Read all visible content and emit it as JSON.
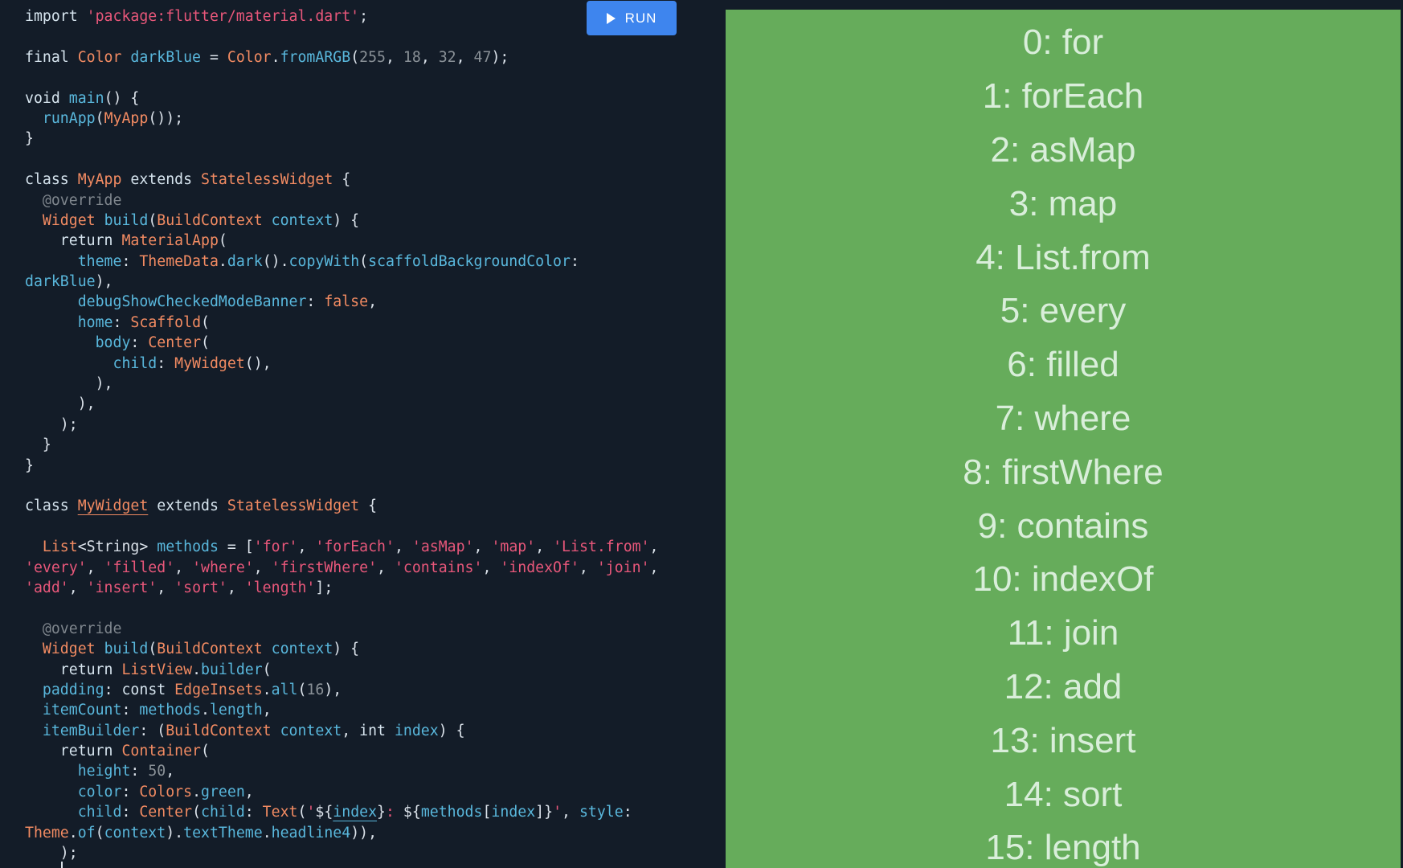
{
  "toolbar": {
    "run_label": "RUN"
  },
  "code_lines": [
    [
      [
        "kw",
        "import "
      ],
      [
        "st",
        "'package:flutter/material.dart'"
      ],
      [
        "pl",
        ";"
      ]
    ],
    [],
    [
      [
        "kw",
        "final "
      ],
      [
        "ty",
        "Color "
      ],
      [
        "id",
        "darkBlue"
      ],
      [
        "pl",
        " = "
      ],
      [
        "ty",
        "Color"
      ],
      [
        "pl",
        "."
      ],
      [
        "id",
        "fromARGB"
      ],
      [
        "pl",
        "("
      ],
      [
        "nu",
        "255"
      ],
      [
        "pl",
        ", "
      ],
      [
        "nu",
        "18"
      ],
      [
        "pl",
        ", "
      ],
      [
        "nu",
        "32"
      ],
      [
        "pl",
        ", "
      ],
      [
        "nu",
        "47"
      ],
      [
        "pl",
        ");"
      ]
    ],
    [],
    [
      [
        "kw",
        "void "
      ],
      [
        "id",
        "main"
      ],
      [
        "pl",
        "() {"
      ]
    ],
    [
      [
        "pl",
        "  "
      ],
      [
        "id",
        "runApp"
      ],
      [
        "pl",
        "("
      ],
      [
        "ty",
        "MyApp"
      ],
      [
        "pl",
        "());"
      ]
    ],
    [
      [
        "pl",
        "}"
      ]
    ],
    [],
    [
      [
        "kw",
        "class "
      ],
      [
        "ty",
        "MyApp "
      ],
      [
        "kw",
        "extends "
      ],
      [
        "ty",
        "StatelessWidget"
      ],
      [
        "pl",
        " {"
      ]
    ],
    [
      [
        "an",
        "  @override"
      ]
    ],
    [
      [
        "pl",
        "  "
      ],
      [
        "ty",
        "Widget "
      ],
      [
        "id",
        "build"
      ],
      [
        "pl",
        "("
      ],
      [
        "ty",
        "BuildContext "
      ],
      [
        "id",
        "context"
      ],
      [
        "pl",
        ") {"
      ]
    ],
    [
      [
        "kw",
        "    return "
      ],
      [
        "ty",
        "MaterialApp"
      ],
      [
        "pl",
        "("
      ]
    ],
    [
      [
        "pl",
        "      "
      ],
      [
        "id",
        "theme"
      ],
      [
        "pl",
        ": "
      ],
      [
        "ty",
        "ThemeData"
      ],
      [
        "pl",
        "."
      ],
      [
        "id",
        "dark"
      ],
      [
        "pl",
        "()."
      ],
      [
        "id",
        "copyWith"
      ],
      [
        "pl",
        "("
      ],
      [
        "id",
        "scaffoldBackgroundColor"
      ],
      [
        "pl",
        ":"
      ]
    ],
    [
      [
        "id",
        "darkBlue"
      ],
      [
        "pl",
        "),"
      ]
    ],
    [
      [
        "pl",
        "      "
      ],
      [
        "id",
        "debugShowCheckedModeBanner"
      ],
      [
        "pl",
        ": "
      ],
      [
        "ty",
        "false"
      ],
      [
        "pl",
        ","
      ]
    ],
    [
      [
        "pl",
        "      "
      ],
      [
        "id",
        "home"
      ],
      [
        "pl",
        ": "
      ],
      [
        "ty",
        "Scaffold"
      ],
      [
        "pl",
        "("
      ]
    ],
    [
      [
        "pl",
        "        "
      ],
      [
        "id",
        "body"
      ],
      [
        "pl",
        ": "
      ],
      [
        "ty",
        "Center"
      ],
      [
        "pl",
        "("
      ]
    ],
    [
      [
        "pl",
        "          "
      ],
      [
        "id",
        "child"
      ],
      [
        "pl",
        ": "
      ],
      [
        "ty",
        "MyWidget"
      ],
      [
        "pl",
        "(),"
      ]
    ],
    [
      [
        "pl",
        "        ),"
      ]
    ],
    [
      [
        "pl",
        "      ),"
      ]
    ],
    [
      [
        "pl",
        "    );"
      ]
    ],
    [
      [
        "pl",
        "  }"
      ]
    ],
    [
      [
        "pl",
        "}"
      ]
    ],
    [],
    [
      [
        "kw",
        "class "
      ],
      [
        "ty ul",
        "MyWidget"
      ],
      [
        "kw",
        " extends "
      ],
      [
        "ty",
        "StatelessWidget"
      ],
      [
        "pl",
        " {"
      ]
    ],
    [],
    [
      [
        "pl",
        "  "
      ],
      [
        "ty",
        "List"
      ],
      [
        "pl",
        "<String> "
      ],
      [
        "id",
        "methods"
      ],
      [
        "pl",
        " = ["
      ],
      [
        "st",
        "'for'"
      ],
      [
        "pl",
        ", "
      ],
      [
        "st",
        "'forEach'"
      ],
      [
        "pl",
        ", "
      ],
      [
        "st",
        "'asMap'"
      ],
      [
        "pl",
        ", "
      ],
      [
        "st",
        "'map'"
      ],
      [
        "pl",
        ", "
      ],
      [
        "st",
        "'List.from'"
      ],
      [
        "pl",
        ","
      ]
    ],
    [
      [
        "st",
        "'every'"
      ],
      [
        "pl",
        ", "
      ],
      [
        "st",
        "'filled'"
      ],
      [
        "pl",
        ", "
      ],
      [
        "st",
        "'where'"
      ],
      [
        "pl",
        ", "
      ],
      [
        "st",
        "'firstWhere'"
      ],
      [
        "pl",
        ", "
      ],
      [
        "st",
        "'contains'"
      ],
      [
        "pl",
        ", "
      ],
      [
        "st",
        "'indexOf'"
      ],
      [
        "pl",
        ", "
      ],
      [
        "st",
        "'join'"
      ],
      [
        "pl",
        ","
      ]
    ],
    [
      [
        "st",
        "'add'"
      ],
      [
        "pl",
        ", "
      ],
      [
        "st",
        "'insert'"
      ],
      [
        "pl",
        ", "
      ],
      [
        "st",
        "'sort'"
      ],
      [
        "pl",
        ", "
      ],
      [
        "st",
        "'length'"
      ],
      [
        "pl",
        "];"
      ]
    ],
    [],
    [
      [
        "an",
        "  @override"
      ]
    ],
    [
      [
        "pl",
        "  "
      ],
      [
        "ty",
        "Widget "
      ],
      [
        "id",
        "build"
      ],
      [
        "pl",
        "("
      ],
      [
        "ty",
        "BuildContext "
      ],
      [
        "id",
        "context"
      ],
      [
        "pl",
        ") {"
      ]
    ],
    [
      [
        "kw",
        "    return "
      ],
      [
        "ty",
        "ListView"
      ],
      [
        "pl",
        "."
      ],
      [
        "id",
        "builder"
      ],
      [
        "pl",
        "("
      ]
    ],
    [
      [
        "pl",
        "  "
      ],
      [
        "id",
        "padding"
      ],
      [
        "pl",
        ": "
      ],
      [
        "kw",
        "const "
      ],
      [
        "ty",
        "EdgeInsets"
      ],
      [
        "pl",
        "."
      ],
      [
        "id",
        "all"
      ],
      [
        "pl",
        "("
      ],
      [
        "nu",
        "16"
      ],
      [
        "pl",
        "),"
      ]
    ],
    [
      [
        "pl",
        "  "
      ],
      [
        "id",
        "itemCount"
      ],
      [
        "pl",
        ": "
      ],
      [
        "id",
        "methods"
      ],
      [
        "pl",
        "."
      ],
      [
        "id",
        "length"
      ],
      [
        "pl",
        ","
      ]
    ],
    [
      [
        "pl",
        "  "
      ],
      [
        "id",
        "itemBuilder"
      ],
      [
        "pl",
        ": ("
      ],
      [
        "ty",
        "BuildContext "
      ],
      [
        "id",
        "context"
      ],
      [
        "pl",
        ", "
      ],
      [
        "kw",
        "int "
      ],
      [
        "id",
        "index"
      ],
      [
        "pl",
        ") {"
      ]
    ],
    [
      [
        "kw",
        "    return "
      ],
      [
        "ty",
        "Container"
      ],
      [
        "pl",
        "("
      ]
    ],
    [
      [
        "pl",
        "      "
      ],
      [
        "id",
        "height"
      ],
      [
        "pl",
        ": "
      ],
      [
        "nu",
        "50"
      ],
      [
        "pl",
        ","
      ]
    ],
    [
      [
        "pl",
        "      "
      ],
      [
        "id",
        "color"
      ],
      [
        "pl",
        ": "
      ],
      [
        "ty",
        "Colors"
      ],
      [
        "pl",
        "."
      ],
      [
        "id",
        "green"
      ],
      [
        "pl",
        ","
      ]
    ],
    [
      [
        "pl",
        "      "
      ],
      [
        "id",
        "child"
      ],
      [
        "pl",
        ": "
      ],
      [
        "ty",
        "Center"
      ],
      [
        "pl",
        "("
      ],
      [
        "id",
        "child"
      ],
      [
        "pl",
        ": "
      ],
      [
        "ty",
        "Text"
      ],
      [
        "pl",
        "("
      ],
      [
        "st",
        "'"
      ],
      [
        "pl",
        "${"
      ],
      [
        "id ul",
        "index"
      ],
      [
        "pl",
        "}"
      ],
      [
        "st",
        ": "
      ],
      [
        "pl",
        "${"
      ],
      [
        "id",
        "methods"
      ],
      [
        "pl",
        "["
      ],
      [
        "id",
        "index"
      ],
      [
        "pl",
        "]}"
      ],
      [
        "st",
        "'"
      ],
      [
        "pl",
        ", "
      ],
      [
        "id",
        "style"
      ],
      [
        "pl",
        ":"
      ]
    ],
    [
      [
        "ty",
        "Theme"
      ],
      [
        "pl",
        "."
      ],
      [
        "id",
        "of"
      ],
      [
        "pl",
        "("
      ],
      [
        "id",
        "context"
      ],
      [
        "pl",
        ")."
      ],
      [
        "id",
        "textTheme"
      ],
      [
        "pl",
        "."
      ],
      [
        "id",
        "headline4"
      ],
      [
        "pl",
        ")),"
      ]
    ],
    [
      [
        "pl",
        "    );"
      ]
    ]
  ],
  "preview": {
    "background": "#66ac5b",
    "items": [
      "0: for",
      "1: forEach",
      "2: asMap",
      "3: map",
      "4: List.from",
      "5: every",
      "6: filled",
      "7: where",
      "8: firstWhere",
      "9: contains",
      "10: indexOf",
      "11: join",
      "12: add",
      "13: insert",
      "14: sort",
      "15: length"
    ]
  }
}
